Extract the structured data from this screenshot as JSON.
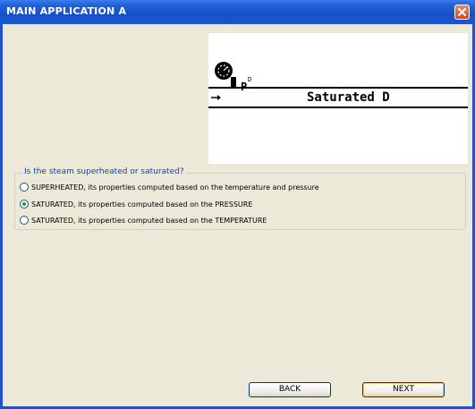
{
  "window": {
    "title": "MAIN APPLICATION A"
  },
  "diagram": {
    "gauge_label": "P",
    "gauge_superscript": "D",
    "caption": "Saturated D"
  },
  "question_group": {
    "legend": "Is the steam superheated or saturated?",
    "options": [
      {
        "label": "SUPERHEATED, its properties computed based on the temperature and pressure",
        "selected": false
      },
      {
        "label": "SATURATED, its properties computed based on the PRESSURE",
        "selected": true
      },
      {
        "label": "SATURATED, its properties computed based on the TEMPERATURE",
        "selected": false
      }
    ]
  },
  "buttons": {
    "back": "BACK",
    "next": "NEXT"
  },
  "colors": {
    "titlebar": "#1451c8",
    "legend_text": "#0046d5",
    "dialog_bg": "#ece9d8"
  }
}
